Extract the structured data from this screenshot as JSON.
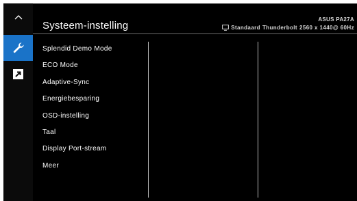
{
  "header": {
    "title": "Systeem-instelling",
    "model": "ASUS PA27A",
    "mode": "Standaard",
    "input": "Thunderbolt",
    "resolution": "2560 x 1440@ 60Hz"
  },
  "sidebar": {
    "up_icon": "chevron-up-icon",
    "items": [
      {
        "icon": "wrench-icon",
        "selected": true
      },
      {
        "icon": "shortcut-arrow-icon",
        "selected": false
      }
    ]
  },
  "menu": {
    "items": [
      "Splendid Demo Mode",
      "ECO Mode",
      "Adaptive-Sync",
      "Energiebesparing",
      "OSD-instelling",
      "Taal",
      "Display Port-stream",
      "Meer"
    ]
  },
  "colors": {
    "accent": "#1a73c8",
    "background": "#000000",
    "text": "#ffffff"
  }
}
